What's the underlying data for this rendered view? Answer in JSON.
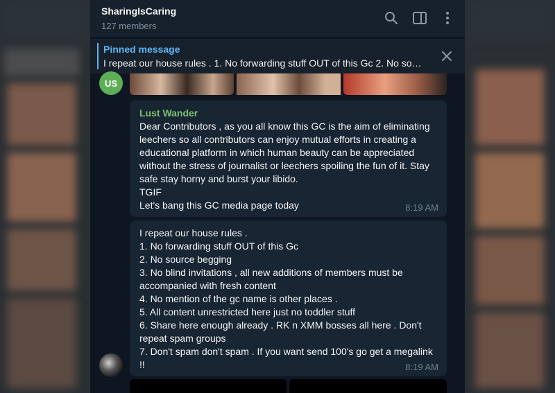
{
  "header": {
    "title": "SharingIsCaring",
    "subtitle": "127 members",
    "icons": [
      "search-icon",
      "sidebar-toggle-icon",
      "more-vert-icon"
    ]
  },
  "pinned": {
    "label": "Pinned message",
    "text": "I repeat our house rules .  1. No forwarding stuff OUT of this Gc 2. No so…"
  },
  "messages": [
    {
      "avatar": "US",
      "avatar_color": "#5caf56"
    },
    {
      "sender": "Lust Wander",
      "sender_color": "#7cc36f",
      "lines": [
        "Dear Contributors , as you all know this GC is the aim of eliminating",
        "leechers so all contributors can enjoy mutual efforts in creating a",
        "educational platform in which human beauty can be appreciated",
        "without the stress of journalist or leechers spoiling the fun of it. Stay",
        "safe stay horny and burst your libido.",
        "TGIF",
        "Let's bang this GC media page today"
      ],
      "time": "8:19 AM"
    },
    {
      "lines": [
        "I repeat our house rules .",
        "1. No forwarding stuff OUT of this Gc",
        "2. No source begging",
        "3. No blind invitations , all new additions of members must be",
        "accompanied with fresh content",
        "4. No mention of the gc name is other places .",
        "5. All content unrestricted here just no toddler stuff",
        "6. Share here enough already . RK n XMM bosses all here . Don't",
        "repeat spam groups",
        "7. Don't spam don't spam . If you want send 100's go get a megalink",
        "!!"
      ],
      "time": "8:19 AM"
    }
  ],
  "colors": {
    "chat_bg": "#0e1621",
    "header_bg": "#17212b",
    "bubble_bg": "#182533",
    "accent": "#5eb5f7"
  }
}
